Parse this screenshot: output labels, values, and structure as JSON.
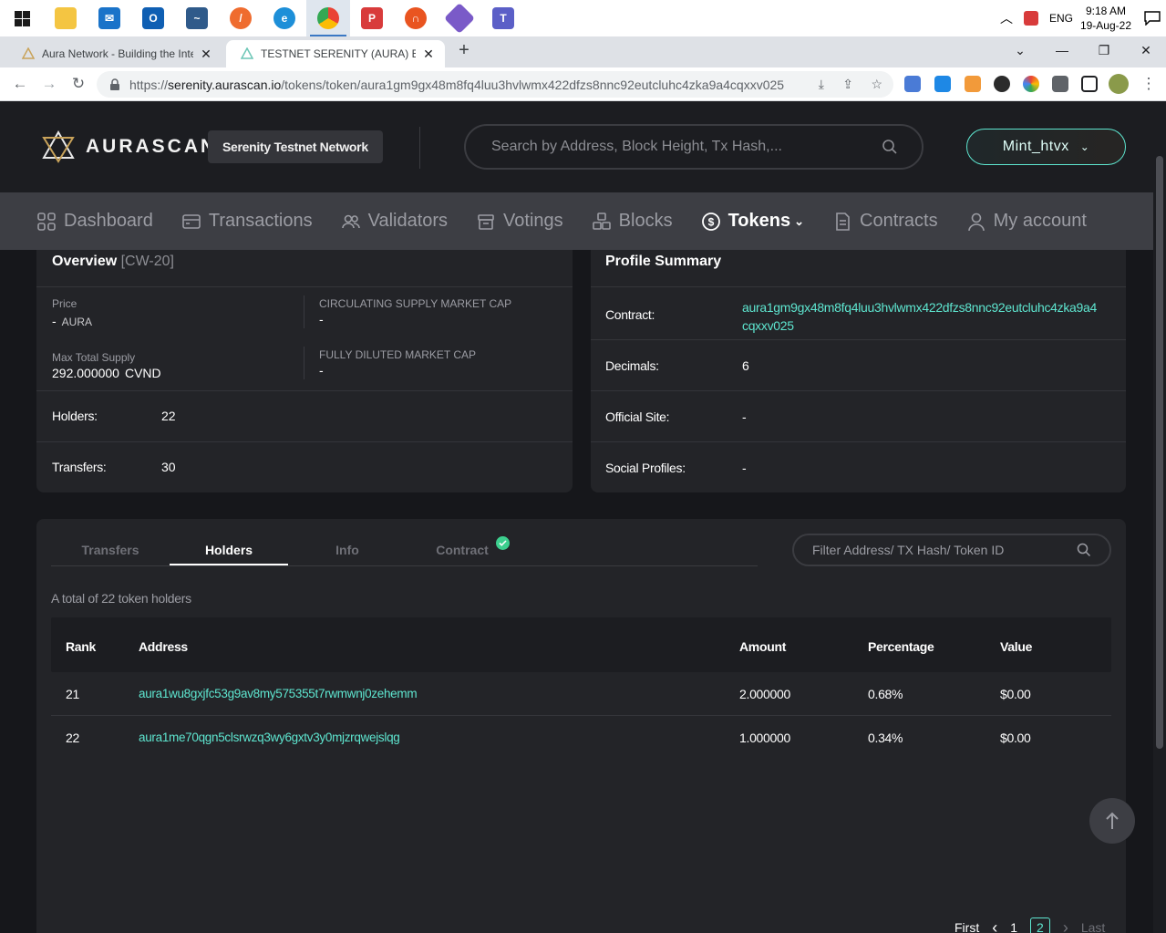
{
  "taskbar": {
    "apps": [
      {
        "icon": "file-explorer-icon",
        "color": "#f4c542"
      },
      {
        "icon": "mail-icon",
        "color": "#1a73c9"
      },
      {
        "icon": "outlook-icon",
        "color": "#0f5fb3"
      },
      {
        "icon": "mysql-workbench-icon",
        "color": "#2f5a8a"
      },
      {
        "icon": "postman-icon",
        "color": "#ef6c2f"
      },
      {
        "icon": "edge-icon",
        "color": "#1d8fd8"
      },
      {
        "icon": "chrome-icon",
        "color": "#34a853"
      },
      {
        "icon": "pdf-reader-icon",
        "color": "#d83b3b"
      },
      {
        "icon": "ubuntu-app-icon",
        "color": "#e95420"
      },
      {
        "icon": "git-icon",
        "color": "#7a5ac8"
      },
      {
        "icon": "teams-icon",
        "color": "#5b5fc7"
      }
    ],
    "language": "ENG",
    "time": "9:18 AM",
    "date": "19-Aug-22",
    "notifications": "1"
  },
  "browser": {
    "tabs": [
      {
        "title": "Aura Network - Building the Inter",
        "active": false
      },
      {
        "title": "TESTNET SERENITY (AURA) Block",
        "active": true
      }
    ],
    "url_prefix": "https://",
    "url_host": "serenity.aurascan.io",
    "url_path": "/tokens/token/aura1gm9gx48m8fq4luu3hvlwmx422dfzs8nnc92eutcluhc4zka9a4cqxxv025"
  },
  "header": {
    "logo_text": "AURASCAN",
    "network": "Serenity Testnet Network",
    "search_placeholder": "Search by Address, Block Height, Tx Hash,...",
    "wallet": "Mint_htvx"
  },
  "nav": [
    {
      "label": "Dashboard",
      "icon": "dashboard-icon"
    },
    {
      "label": "Transactions",
      "icon": "transactions-icon"
    },
    {
      "label": "Validators",
      "icon": "validators-icon"
    },
    {
      "label": "Votings",
      "icon": "votings-icon"
    },
    {
      "label": "Blocks",
      "icon": "blocks-icon"
    },
    {
      "label": "Tokens",
      "icon": "tokens-icon",
      "active": true
    },
    {
      "label": "Contracts",
      "icon": "contracts-icon"
    },
    {
      "label": "My account",
      "icon": "account-icon"
    }
  ],
  "overview": {
    "title": "Overview",
    "subtitle": "[CW-20]",
    "price_label": "Price",
    "price_value": "-",
    "price_unit": "AURA",
    "circ_label": "CIRCULATING SUPPLY MARKET CAP",
    "circ_value": "-",
    "max_label": "Max Total Supply",
    "max_value": "292.000000",
    "max_unit": "CVND",
    "fdmc_label": "FULLY DILUTED MARKET CAP",
    "fdmc_value": "-",
    "holders_label": "Holders:",
    "holders_value": "22",
    "transfers_label": "Transfers:",
    "transfers_value": "30"
  },
  "profile": {
    "title": "Profile Summary",
    "contract_label": "Contract:",
    "contract_line1": "aura1gm9gx48m8fq4luu3hvlwmx422dfzs8nnc92eutcluhc4zka9a4",
    "contract_line2": "cqxxv025",
    "decimals_label": "Decimals:",
    "decimals_value": "6",
    "site_label": "Official Site:",
    "site_value": "-",
    "social_label": "Social Profiles:",
    "social_value": "-"
  },
  "holders": {
    "tabs": [
      "Transfers",
      "Holders",
      "Info",
      "Contract"
    ],
    "filter_placeholder": "Filter Address/ TX Hash/ Token ID",
    "total_text": "A total of 22 token holders",
    "columns": [
      "Rank",
      "Address",
      "Amount",
      "Percentage",
      "Value"
    ],
    "rows": [
      {
        "rank": "21",
        "address": "aura1wu8gxjfc53g9av8my575355t7rwmwnj0zehemm",
        "amount": "2.000000",
        "percentage": "0.68%",
        "value": "$0.00"
      },
      {
        "rank": "22",
        "address": "aura1me70qgn5clsrwzq3wy6gxtv3y0mjzrqwejslqg",
        "amount": "1.000000",
        "percentage": "0.34%",
        "value": "$0.00"
      }
    ],
    "pager": {
      "first": "First",
      "prev": "‹",
      "pages": [
        "1",
        "2"
      ],
      "current": "2",
      "next": "›",
      "last": "Last"
    }
  }
}
